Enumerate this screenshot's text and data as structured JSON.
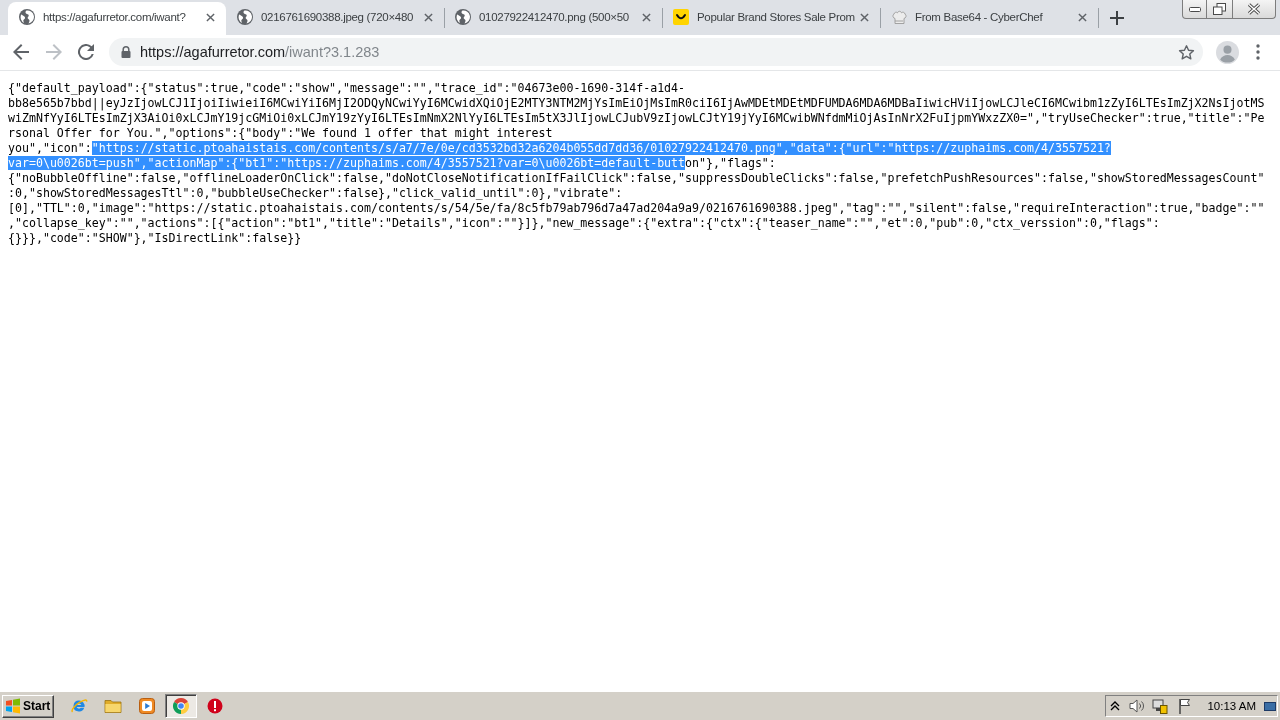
{
  "tabs": [
    {
      "title": "https://agafurretor.com/iwant?",
      "kind": "generic",
      "selected": true
    },
    {
      "title": "0216761690388.jpeg (720×480",
      "kind": "generic",
      "selected": false
    },
    {
      "title": "01027922412470.png (500×50",
      "kind": "generic",
      "selected": false
    },
    {
      "title": "Popular Brand Stores Sale Prom",
      "kind": "smiley",
      "selected": false
    },
    {
      "title": "From Base64 - CyberChef",
      "kind": "hat",
      "selected": false
    }
  ],
  "navigation": {
    "back_disabled": false,
    "forward_disabled": true
  },
  "address_bar": {
    "origin": "https://agafurretor.com",
    "path": "/iwant?3.1.283"
  },
  "page": {
    "lines": [
      [
        {
          "text": "{\"default_payload\":{\"status\":true,\"code\":\"show\",\"message\":\"\",\"trace_id\":\"04673e00-1690-314f-a1d4-",
          "selected": false
        }
      ],
      [
        {
          "text": "bb8e565b7bbd||eyJzIjowLCJ1IjoiIiwieiI6MCwiYiI6MjI2ODQyNCwiYyI6MCwidXQiOjE2MTY3NTM2MjYsImEiOjMsImR0ciI6IjAwMDEtMDEtMDFUMDA6MDA6MDBaIiwicHViIjowLCJleCI6MCwibm1zZyI6LTEsImZjX2NsIjotMS",
          "selected": false
        }
      ],
      [
        {
          "text": "wiZmNfYyI6LTEsImZjX3AiOi0xLCJmY19jcGMiOi0xLCJmY19zYyI6LTEsImNmX2NlYyI6LTEsIm5tX3JlIjowLCJubV9zIjowLCJtY19jYyI6MCwibWNfdmMiOjAsInNrX2FuIjpmYWxzZX0=\",\"tryUseChecker\":true,\"title\":\"Pe",
          "selected": false
        }
      ],
      [
        {
          "text": "rsonal Offer for You.\",\"options\":{\"body\":\"We found 1 offer that might interest",
          "selected": false
        }
      ],
      [
        {
          "text": "you\",\"icon\":",
          "selected": false
        },
        {
          "text": "\"https://static.ptoahaistais.com/contents/s/a7/7e/0e/cd3532bd32a6204b055dd7dd36/01027922412470.png\",\"data\":{\"url\":\"https://zuphaims.com/4/3557521?",
          "selected": true
        }
      ],
      [
        {
          "text": "var=0\\u0026bt=push\",\"actionMap\":{\"bt1\":\"https://zuphaims.com/4/3557521?var=0\\u0026bt=default-butt",
          "selected": true
        },
        {
          "text": "on\"},\"flags\":",
          "selected": false
        }
      ],
      [
        {
          "text": "{\"noBubbleOffline\":false,\"offlineLoaderOnClick\":false,\"doNotCloseNotificationIfFailClick\":false,\"suppressDoubleClicks\":false,\"prefetchPushResources\":false,\"showStoredMessagesCount\"",
          "selected": false
        }
      ],
      [
        {
          "text": ":0,\"showStoredMessagesTtl\":0,\"bubbleUseChecker\":false},\"click_valid_until\":0},\"vibrate\":",
          "selected": false
        }
      ],
      [
        {
          "text": "[0],\"TTL\":0,\"image\":\"https://static.ptoahaistais.com/contents/s/54/5e/fa/8c5fb79ab796d7a47ad204a9a9/0216761690388.jpeg\",\"tag\":\"\",\"silent\":false,\"requireInteraction\":true,\"badge\":\"\"",
          "selected": false
        }
      ],
      [
        {
          "text": ",\"collapse_key\":\"\",\"actions\":[{\"action\":\"bt1\",\"title\":\"Details\",\"icon\":\"\"}]},\"new_message\":{\"extra\":{\"ctx\":{\"teaser_name\":\"\",\"et\":0,\"pub\":0,\"ctx_verssion\":0,\"flags\":",
          "selected": false
        }
      ],
      [
        {
          "text": "{}}},\"code\":\"SHOW\"},\"IsDirectLink\":false}}",
          "selected": false
        }
      ]
    ]
  },
  "taskbar": {
    "start_label": "Start",
    "apps": [
      {
        "kind": "e",
        "selected": false
      },
      {
        "kind": "folder",
        "selected": false
      },
      {
        "kind": "player",
        "selected": false
      },
      {
        "kind": "wheel",
        "selected": true
      },
      {
        "kind": "alert",
        "selected": false
      }
    ],
    "clock": "10:13 AM"
  }
}
